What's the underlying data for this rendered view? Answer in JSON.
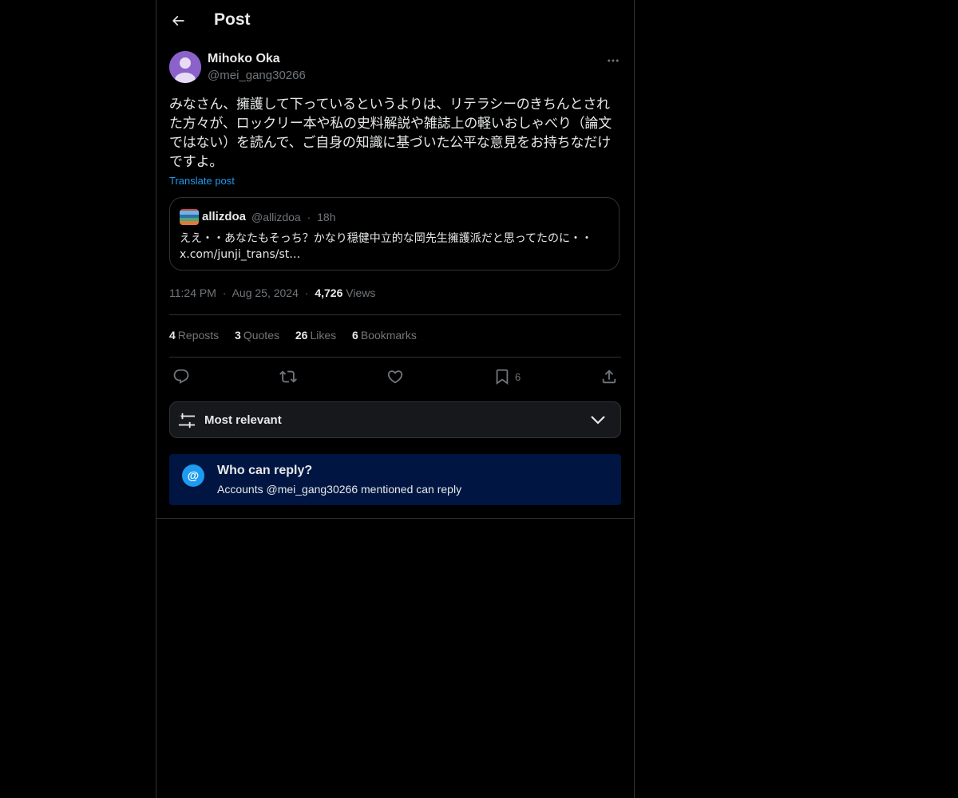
{
  "header": {
    "title": "Post"
  },
  "post": {
    "author_name": "Mihoko Oka",
    "author_handle": "@mei_gang30266",
    "text": "みなさん、擁護して下っているというよりは、リテラシーのきちんとされた方々が、ロックリー本や私の史料解説や雑誌上の軽いおしゃべり（論文ではない）を読んで、ご自身の知識に基づいた公平な意見をお持ちなだけですよ。",
    "translate_label": "Translate post",
    "time": "11:24 PM",
    "date": "Aug 25, 2024",
    "views_count": "4,726",
    "views_label": "Views",
    "separator": "·"
  },
  "quote": {
    "name": "allizdoa",
    "handle": "@allizdoa",
    "age": "18h",
    "separator": "·",
    "text": "ええ・・あなたもそっち？かなり穏健中立的な岡先生擁護派だと思ってたのに・・ x.com/junji_trans/st…"
  },
  "stats": [
    {
      "count": "4",
      "label": "Reposts"
    },
    {
      "count": "3",
      "label": "Quotes"
    },
    {
      "count": "26",
      "label": "Likes"
    },
    {
      "count": "6",
      "label": "Bookmarks"
    }
  ],
  "actions": {
    "bookmark_count": "6",
    "icons": [
      "reply-icon",
      "repost-icon",
      "like-icon",
      "bookmark-icon",
      "share-icon"
    ]
  },
  "sort": {
    "label": "Most relevant"
  },
  "reply_restriction": {
    "title": "Who can reply?",
    "description": "Accounts @mei_gang30266 mentioned can reply",
    "icon_glyph": "@"
  },
  "colors": {
    "background": "#000000",
    "text": "#e7e9ea",
    "muted": "#71767b",
    "accent": "#1d9bf0",
    "reply_box": "#001541"
  }
}
